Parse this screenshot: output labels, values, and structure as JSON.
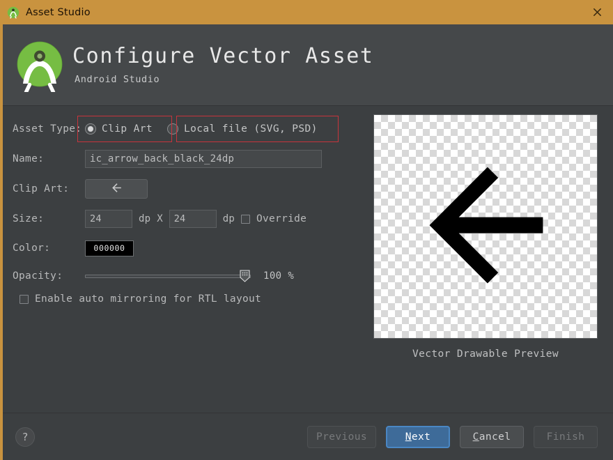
{
  "titlebar": {
    "title": "Asset Studio",
    "app_icon": "android-studio-icon",
    "close_label": "✕"
  },
  "header": {
    "title": "Configure Vector Asset",
    "subtitle": "Android Studio",
    "logo": "android-studio-logo"
  },
  "form": {
    "asset_type": {
      "label": "Asset Type:",
      "options": [
        {
          "label": "Clip Art",
          "selected": true,
          "highlighted": true
        },
        {
          "label": "Local file (SVG, PSD)",
          "selected": false,
          "highlighted": true
        }
      ]
    },
    "name": {
      "label": "Name:",
      "value": "ic_arrow_back_black_24dp"
    },
    "clip_art": {
      "label": "Clip Art:",
      "icon": "arrow-back-icon"
    },
    "size": {
      "label": "Size:",
      "width": "24",
      "height": "24",
      "unit": "dp",
      "separator": "X",
      "override_label": "Override",
      "override_checked": false
    },
    "color": {
      "label": "Color:",
      "value": "000000",
      "hex": "#000000"
    },
    "opacity": {
      "label": "Opacity:",
      "value": 100,
      "display": "100 %"
    },
    "mirroring": {
      "label": "Enable auto mirroring for RTL layout",
      "checked": false
    }
  },
  "preview": {
    "caption": "Vector Drawable Preview",
    "icon": "arrow-back-icon"
  },
  "footer": {
    "help_label": "?",
    "buttons": [
      {
        "label": "Previous",
        "state": "disabled",
        "mnemonic": ""
      },
      {
        "label": "Next",
        "state": "primary",
        "mnemonic": "N"
      },
      {
        "label": "Cancel",
        "state": "normal",
        "mnemonic": "C"
      },
      {
        "label": "Finish",
        "state": "disabled",
        "mnemonic": ""
      }
    ]
  },
  "colors": {
    "titlebar": "#c9933f",
    "accent_stripe": "#c9933f",
    "body": "#3c3f41",
    "header_band": "#45484a",
    "annotation": "#c8343c",
    "primary_button": "#3e6b99",
    "logo_green": "#76bd43"
  }
}
